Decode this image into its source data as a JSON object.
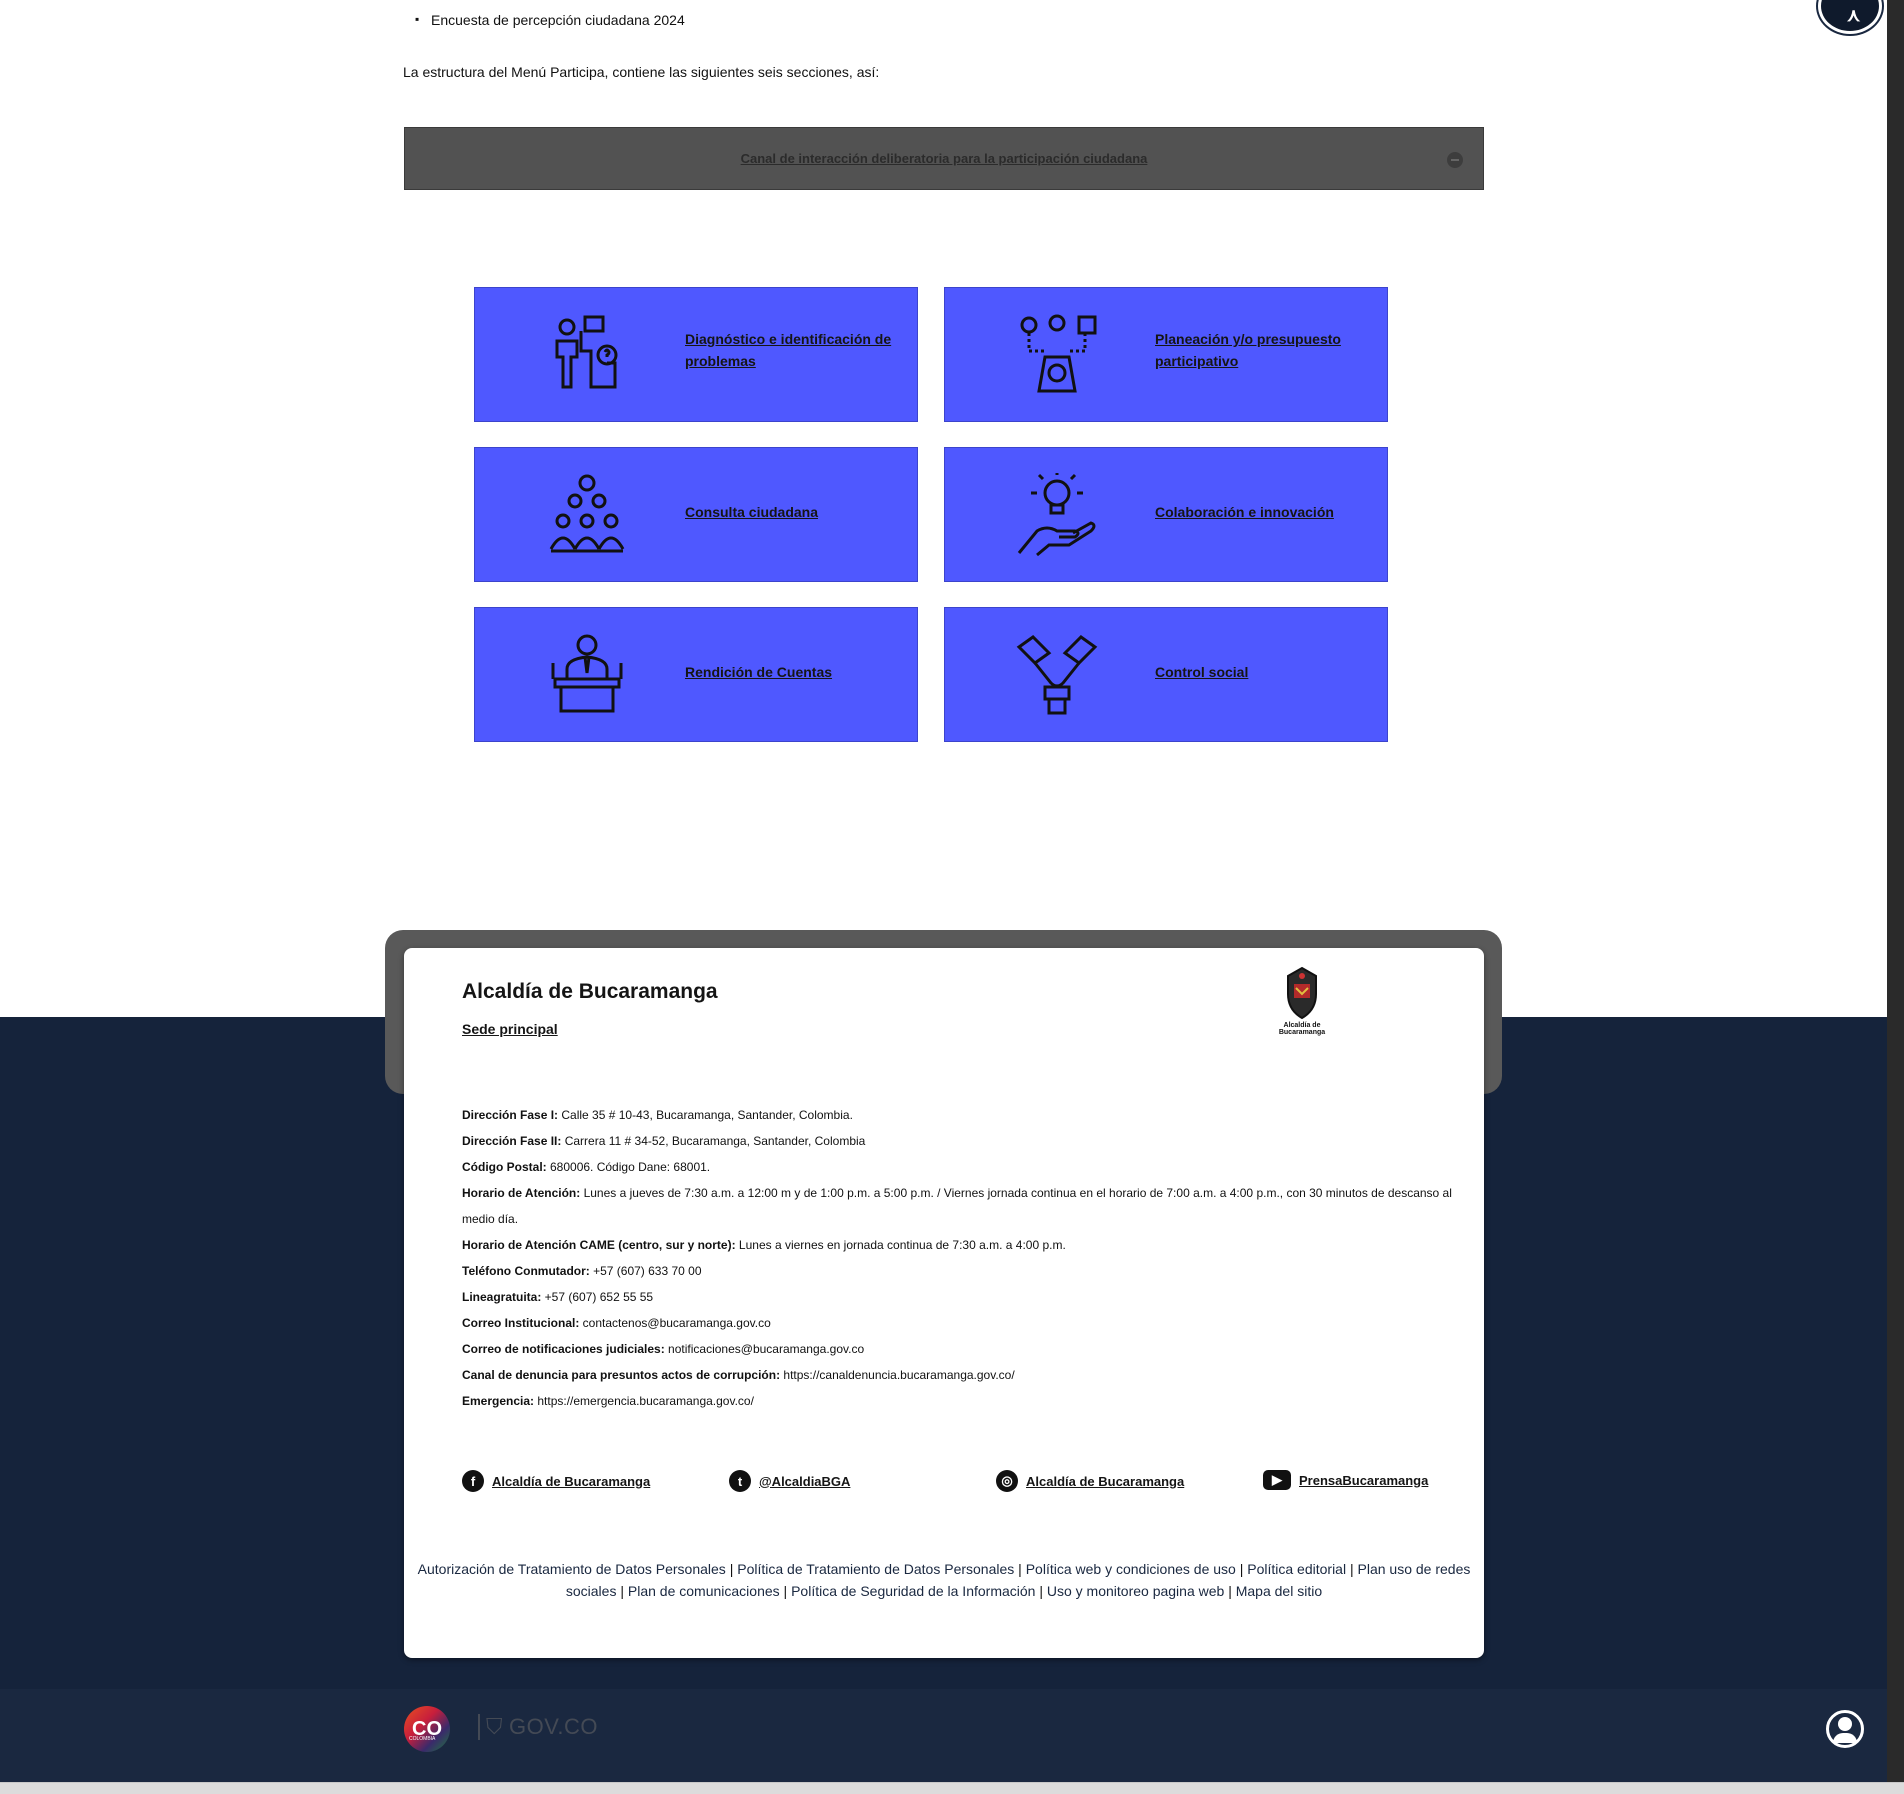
{
  "content": {
    "bullet_item": "Encuesta de percepción ciudadana 2024",
    "intro_text": "La estructura del Menú Participa, contiene las siguientes seis secciones, así:"
  },
  "accordion": {
    "title": "Canal de interacción deliberatoria para la participación ciudadana"
  },
  "tiles": [
    {
      "label": "Diagnóstico e identificación de problemas",
      "icon": "problem-solving-icon"
    },
    {
      "label": "Planeación y/o presupuesto participativo",
      "icon": "budget-planning-icon"
    },
    {
      "label": "Consulta ciudadana",
      "icon": "people-group-icon"
    },
    {
      "label": "Colaboración e innovación",
      "icon": "lightbulb-hand-icon"
    },
    {
      "label": "Rendición de Cuentas",
      "icon": "speaker-podium-icon"
    },
    {
      "label": "Control social",
      "icon": "handshake-icon"
    }
  ],
  "colors": {
    "tile_bg": "#4f58ff",
    "footer_bg": "#15233b",
    "accordion_bg": "#525252"
  },
  "footer": {
    "org_name": "Alcaldía de Bucaramanga",
    "sede_link": "Sede principal",
    "logo_text": "Alcaldía de Bucaramanga",
    "info": [
      {
        "label": "Dirección Fase I:",
        "value": " Calle 35 # 10-43, Bucaramanga, Santander, Colombia."
      },
      {
        "label": "Dirección Fase II:",
        "value": " Carrera 11 # 34-52, Bucaramanga, Santander, Colombia"
      },
      {
        "label": "Código Postal:",
        "value": " 680006. Código Dane: 68001."
      },
      {
        "label": "Horario de Atención:",
        "value": " Lunes a jueves de 7:30 a.m. a 12:00 m y de 1:00 p.m. a 5:00 p.m. / Viernes jornada continua en el horario de 7:00 a.m. a 4:00 p.m., con 30 minutos de descanso al medio día."
      },
      {
        "label": "Horario de Atención CAME (centro, sur y norte):",
        "value": " Lunes a viernes en jornada continua de 7:30 a.m. a 4:00 p.m."
      },
      {
        "label": "Teléfono Conmutador:",
        "value": "   +57 (607) 633 70 00"
      },
      {
        "label": "Lineagratuita:",
        "value": " +57 (607) 652 55 55"
      },
      {
        "label": "Correo Institucional:",
        "value": " contactenos@bucaramanga.gov.co"
      },
      {
        "label": "Correo de notificaciones judiciales:",
        "value": " notificaciones@bucaramanga.gov.co"
      },
      {
        "label": "Canal de denuncia para presuntos actos de corrupción:",
        "value": " https://canaldenuncia.bucaramanga.gov.co/"
      },
      {
        "label": "Emergencia:",
        "value": " https://emergencia.bucaramanga.gov.co/"
      }
    ],
    "socials": [
      {
        "icon": "facebook-icon",
        "glyph": "f",
        "label": "Alcaldía de Bucaramanga"
      },
      {
        "icon": "twitter-icon",
        "glyph": "t",
        "label": "@AlcaldiaBGA"
      },
      {
        "icon": "instagram-icon",
        "glyph": "◎",
        "label": "Alcaldía de Bucaramanga"
      },
      {
        "icon": "youtube-icon",
        "glyph": "▶",
        "label": "PrensaBucaramanga"
      }
    ],
    "policies": [
      "Autorización de Tratamiento de Datos Personales",
      "Política de Tratamiento de Datos Personales",
      "Política web y condiciones de uso",
      "Política editorial",
      "Plan uso de redes sociales",
      "Plan de comunicaciones",
      "Política de Seguridad de la Información",
      "Uso y monitoreo pagina web",
      "Mapa del sitio"
    ],
    "separator": " | "
  },
  "bottom_bar": {
    "co_text": "CO",
    "co_sub": "COLOMBIA",
    "govco_text": "GOV.CO"
  }
}
